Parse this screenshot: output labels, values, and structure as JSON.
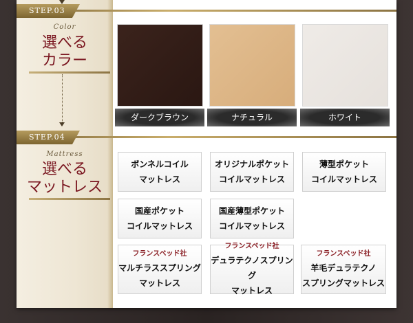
{
  "step3": {
    "badge": "STEP.03",
    "subtitle": "Color",
    "title_line1": "選べる",
    "title_line2": "カラー"
  },
  "step4": {
    "badge": "STEP.04",
    "subtitle": "Mattress",
    "title_line1": "選べる",
    "title_line2": "マットレス"
  },
  "colors": [
    {
      "label": "ダークブラウン",
      "hex": "#2f1c16"
    },
    {
      "label": "ナチュラル",
      "hex": "#ddb586"
    },
    {
      "label": "ホワイト",
      "hex": "#ebe7e2"
    }
  ],
  "mattresses": [
    {
      "line1": "ボンネルコイル",
      "line2": "マットレス"
    },
    {
      "line1": "オリジナルポケット",
      "line2": "コイルマットレス"
    },
    {
      "line1": "薄型ポケット",
      "line2": "コイルマットレス"
    },
    {
      "line1": "国産ポケット",
      "line2": "コイルマットレス"
    },
    {
      "line1": "国産薄型ポケット",
      "line2": "コイルマットレス"
    },
    {
      "brand": "フランスベッド社",
      "line1": "マルチラススプリング",
      "line2": "マットレス"
    },
    {
      "brand": "フランスベッド社",
      "line1": "デュラテクノスプリング",
      "line2": "マットレス"
    },
    {
      "brand": "フランスベッド社",
      "line1": "羊毛デュラテクノ",
      "line2": "スプリングマットレス"
    }
  ]
}
